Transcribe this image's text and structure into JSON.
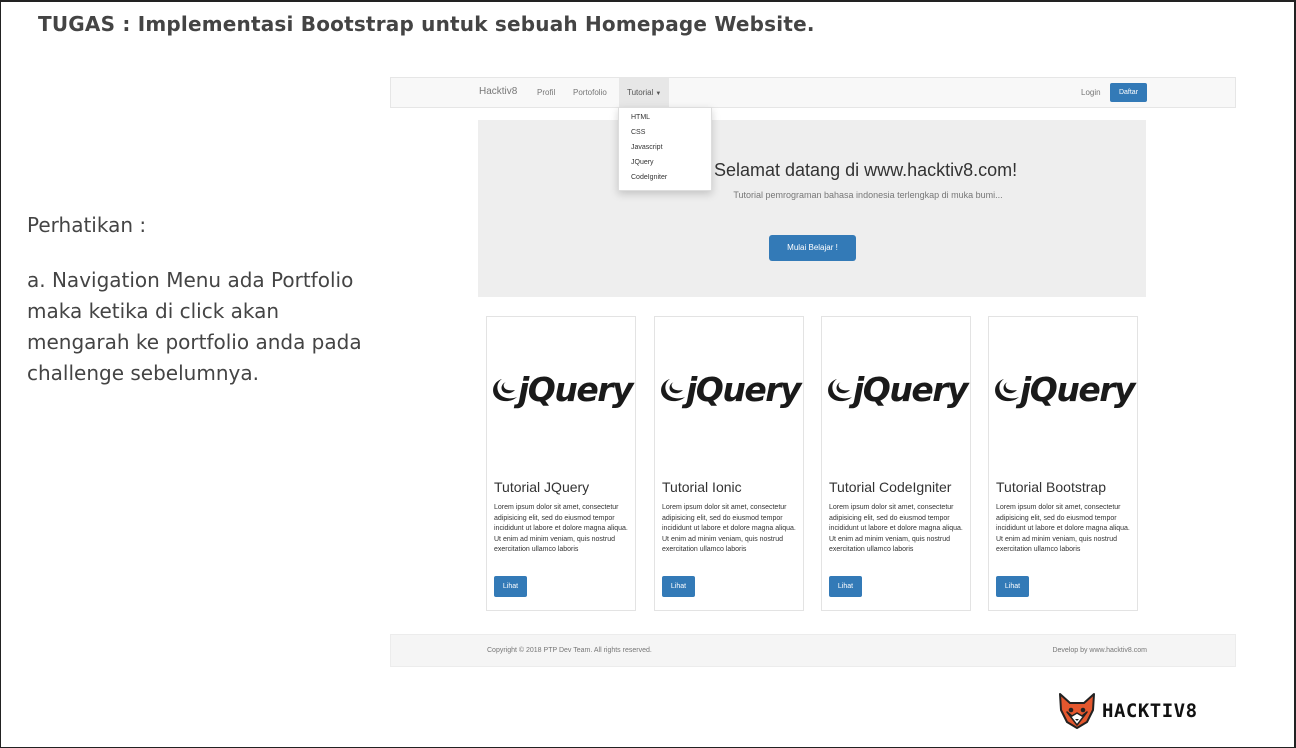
{
  "slide": {
    "title": "TUGAS : Implementasi Bootstrap untuk sebuah Homepage Website.",
    "note_heading": "Perhatikan :",
    "note_body": "a. Navigation Menu ada Portfolio maka ketika di click akan mengarah ke portfolio anda pada challenge sebelumnya.",
    "brand": "HACKTIV8"
  },
  "navbar": {
    "brand": "Hacktiv8",
    "items": [
      "Profil",
      "Portofolio",
      "Tutorial"
    ],
    "login": "Login",
    "daftar": "Daftar",
    "dropdown": [
      "HTML",
      "CSS",
      "Javascript",
      "JQuery",
      "CodeIgniter"
    ]
  },
  "jumbotron": {
    "title": "Selamat datang di www.hacktiv8.com!",
    "subtitle": "Tutorial pemrograman bahasa indonesia terlengkap di muka bumi...",
    "button": "Mulai Belajar !"
  },
  "cards": [
    {
      "logo": "jQuery",
      "title": "Tutorial JQuery",
      "text": "Lorem ipsum dolor sit amet, consectetur adipisicing elit, sed do eiusmod tempor incididunt ut labore et dolore magna aliqua. Ut enim ad minim veniam, quis nostrud exercitation ullamco laboris",
      "button": "Lihat"
    },
    {
      "logo": "jQuery",
      "title": "Tutorial Ionic",
      "text": "Lorem ipsum dolor sit amet, consectetur adipisicing elit, sed do eiusmod tempor incididunt ut labore et dolore magna aliqua. Ut enim ad minim veniam, quis nostrud exercitation ullamco laboris",
      "button": "Lihat"
    },
    {
      "logo": "jQuery",
      "title": "Tutorial CodeIgniter",
      "text": "Lorem ipsum dolor sit amet, consectetur adipisicing elit, sed do eiusmod tempor incididunt ut labore et dolore magna aliqua. Ut enim ad minim veniam, quis nostrud exercitation ullamco laboris",
      "button": "Lihat"
    },
    {
      "logo": "jQuery",
      "title": "Tutorial Bootstrap",
      "text": "Lorem ipsum dolor sit amet, consectetur adipisicing elit, sed do eiusmod tempor incididunt ut labore et dolore magna aliqua. Ut enim ad minim veniam, quis nostrud exercitation ullamco laboris",
      "button": "Lihat"
    }
  ],
  "footer": {
    "copyright": "Copyright © 2018 PTP Dev Team. All rights reserved.",
    "develop": "Develop by www.hacktiv8.com"
  },
  "colors": {
    "primary": "#337ab7",
    "jumbotron": "#eeeeee",
    "navbar": "#f8f8f8"
  }
}
